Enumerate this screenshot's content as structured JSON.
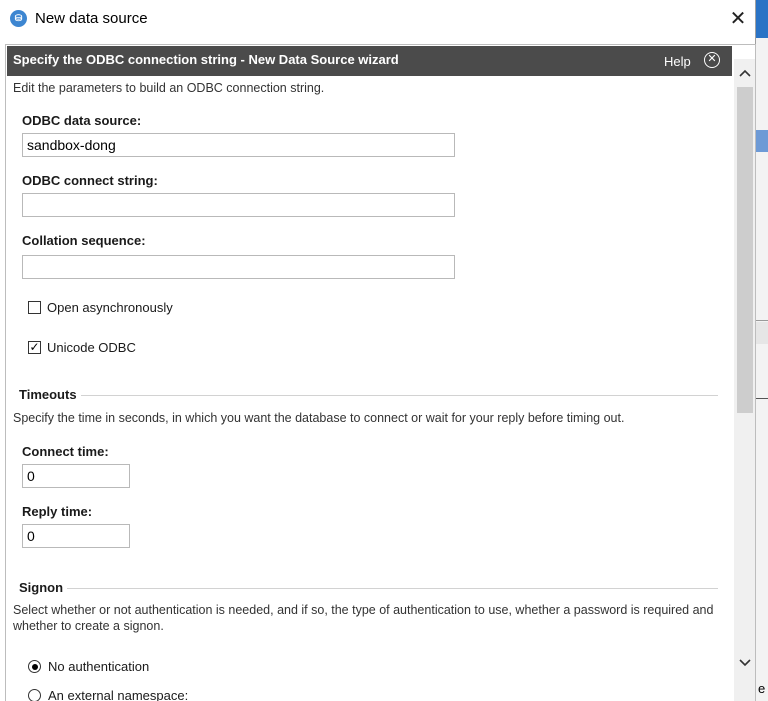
{
  "window": {
    "title": "New data source",
    "close_glyph": "✕",
    "icon": "data-source-app-icon"
  },
  "wizard": {
    "title": "Specify the ODBC connection string - New Data Source wizard",
    "help_label": "Help",
    "intro": "Edit the parameters to build an ODBC connection string."
  },
  "fields": {
    "odbc_source_label": "ODBC data source:",
    "odbc_source_value": "sandbox-dong",
    "connect_string_label": "ODBC connect string:",
    "connect_string_value": "",
    "collation_label": "Collation sequence:",
    "collation_value": ""
  },
  "options": {
    "open_async_label": "Open asynchronously",
    "open_async_checked": false,
    "unicode_label": "Unicode ODBC",
    "unicode_checked": true
  },
  "timeouts": {
    "title": "Timeouts",
    "description": "Specify the time in seconds, in which you want the database to connect or wait for your reply before timing out.",
    "connect_label": "Connect time:",
    "connect_value": "0",
    "reply_label": "Reply time:",
    "reply_value": "0"
  },
  "signon": {
    "title": "Signon",
    "description": "Select whether or not authentication is needed, and if so, the type of authentication to use, whether a password is required and whether to create a signon.",
    "radio_no_auth": "No authentication",
    "radio_external": "An external namespace:"
  },
  "scrollbar": {
    "up_glyph": "^",
    "down_glyph": "⌄"
  },
  "background": {
    "edge_letter": "e"
  }
}
